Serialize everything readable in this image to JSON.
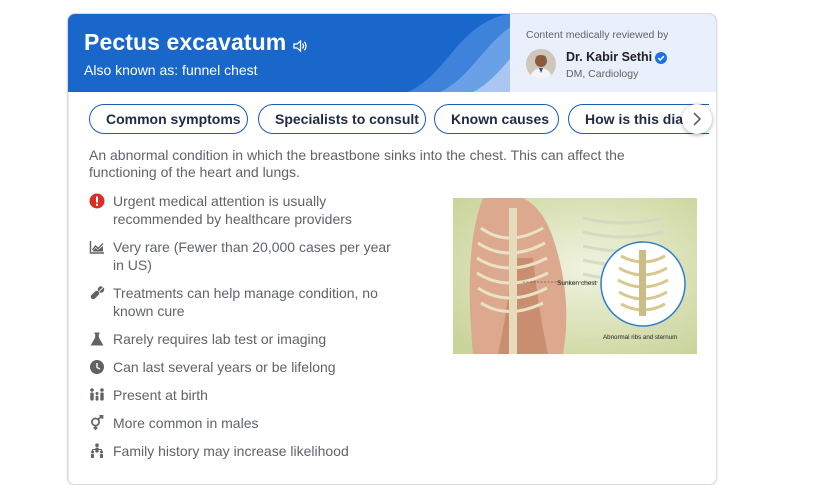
{
  "header": {
    "title": "Pectus excavatum",
    "aka": "Also known as: funnel chest",
    "speaker_icon": "speaker-icon"
  },
  "reviewer": {
    "label": "Content medically reviewed by",
    "name": "Dr. Kabir Sethi",
    "title": "DM, Cardiology",
    "badge_icon": "verified-check-icon"
  },
  "chips": [
    {
      "label": "Common symptoms"
    },
    {
      "label": "Specialists to consult"
    },
    {
      "label": "Known causes"
    },
    {
      "label": "How is this diagnosed?"
    }
  ],
  "description": "An abnormal condition in which the breastbone sinks into the chest. This can affect the functioning of the heart and lungs.",
  "facts": [
    {
      "icon": "urgent-alert-icon",
      "text": "Urgent medical attention is usually recommended by healthcare providers"
    },
    {
      "icon": "chart-icon",
      "text": "Very rare (Fewer than 20,000 cases per year in US)"
    },
    {
      "icon": "pills-icon",
      "text": "Treatments can help manage condition, no known cure"
    },
    {
      "icon": "lab-flask-icon",
      "text": "Rarely requires lab test or imaging"
    },
    {
      "icon": "clock-icon",
      "text": "Can last several years or be lifelong"
    },
    {
      "icon": "family-icon",
      "text": "Present at birth"
    },
    {
      "icon": "gender-icon",
      "text": "More common in males"
    },
    {
      "icon": "family-history-icon",
      "text": "Family history may increase likelihood"
    }
  ],
  "illustration": {
    "label_sunken": "Sunken chest",
    "label_abnormal": "Abnormal ribs and sternum"
  },
  "colors": {
    "header_blue": "#1a67cc",
    "reviewer_bg": "#e9f0fc",
    "chip_border": "#1a5bb8",
    "urgent_red": "#d93025"
  }
}
